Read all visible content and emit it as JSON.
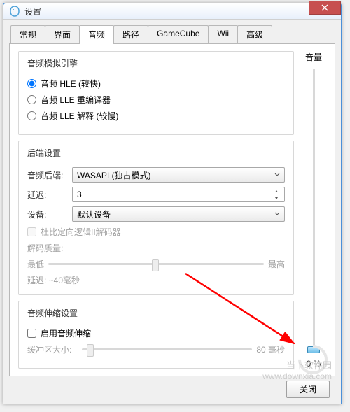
{
  "window": {
    "title": "设置"
  },
  "tabs": {
    "items": [
      {
        "label": "常规"
      },
      {
        "label": "界面"
      },
      {
        "label": "音频"
      },
      {
        "label": "路径"
      },
      {
        "label": "GameCube"
      },
      {
        "label": "Wii"
      },
      {
        "label": "高级"
      }
    ]
  },
  "engine": {
    "legend": "音频模拟引擎",
    "opt1": "音频 HLE (较快)",
    "opt2": "音频 LLE 重编译器",
    "opt3": "音频 LLE 解释 (较慢)"
  },
  "backend": {
    "legend": "后端设置",
    "backend_label": "音频后端:",
    "backend_value": "WASAPI (独占模式)",
    "latency_label": "延迟:",
    "latency_value": "3",
    "device_label": "设备:",
    "device_value": "默认设备",
    "dolby_label": "杜比定向逻辑II解码器",
    "quality_label": "解码质量:",
    "quality_low": "最低",
    "quality_high": "最高",
    "latency_info": "延迟: ~40毫秒"
  },
  "stretch": {
    "legend": "音频伸缩设置",
    "enable_label": "启用音频伸缩",
    "buffer_label": "缓冲区大小:",
    "buffer_value": "80 毫秒"
  },
  "volume": {
    "label": "音量",
    "value": "0 %"
  },
  "footer": {
    "close": "关闭"
  },
  "watermark": {
    "site": "当下软件园",
    "url": "www.downxia.com"
  }
}
